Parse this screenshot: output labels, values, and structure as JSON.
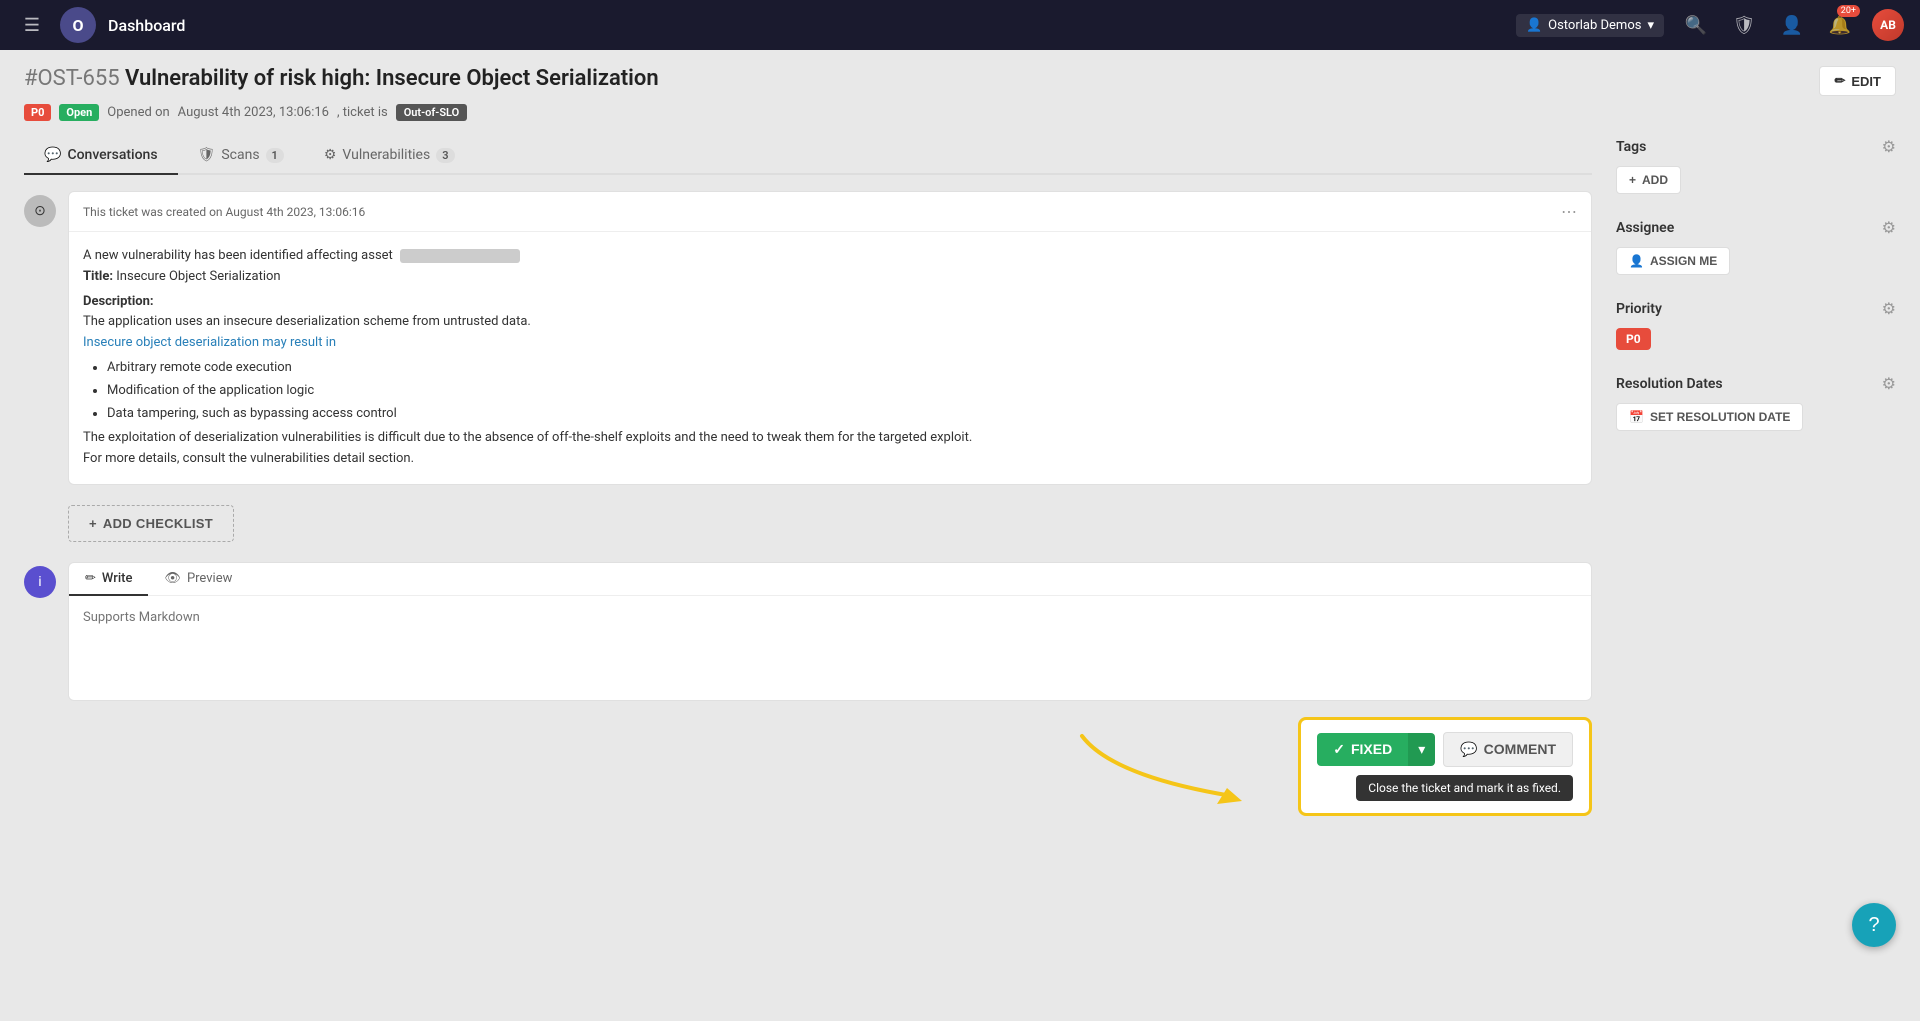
{
  "navbar": {
    "hamburger_label": "☰",
    "logo_text": "O",
    "title": "Dashboard",
    "org_name": "Ostorlab Demos",
    "search_icon": "🔍",
    "shield_icon": "🛡",
    "user_icon": "👤",
    "bell_icon": "🔔",
    "notification_count": "20+",
    "avatar_initials": "AB"
  },
  "ticket": {
    "id": "#OST-655",
    "title": "Vulnerability of risk high: Insecure Object Serialization",
    "priority_badge": "P0",
    "status_badge": "Open",
    "opened_text": "Opened on",
    "opened_date": "August 4th 2023, 13:06:16",
    "ticket_is_text": ", ticket is",
    "slo_badge": "Out-of-SLO",
    "edit_label": "EDIT"
  },
  "tabs": {
    "conversations": {
      "label": "Conversations",
      "active": true,
      "icon": "💬"
    },
    "scans": {
      "label": "Scans",
      "count": "1",
      "icon": "🛡"
    },
    "vulnerabilities": {
      "label": "Vulnerabilities",
      "count": "3",
      "icon": "⚙"
    }
  },
  "comment": {
    "header_text": "This ticket was created on August 4th 2023, 13:06:16",
    "more_icon": "⋯",
    "body": {
      "intro": "A new vulnerability has been identified affecting asset",
      "title_label": "Title:",
      "title_value": "Insecure Object Serialization",
      "description_label": "Description:",
      "desc_text": "The application uses an insecure deserialization scheme from untrusted data.",
      "blue_text": "Insecure object deserialization may result in",
      "bullets": [
        "Arbitrary remote code execution",
        "Modification of the application logic",
        "Data tampering, such as bypassing access control"
      ],
      "closing_text1": "The exploitation of deserialization vulnerabilities is difficult due to the absence of off-the-shelf exploits and the need to tweak them for the targeted exploit.",
      "closing_text2": "For more details, consult the vulnerabilities detail section."
    }
  },
  "add_checklist": {
    "label": "ADD CHECKLIST",
    "plus_icon": "+"
  },
  "write_section": {
    "write_tab_label": "Write",
    "preview_tab_label": "Preview",
    "write_icon": "✏",
    "preview_icon": "👁",
    "placeholder": "Supports Markdown"
  },
  "action_buttons": {
    "fixed_label": "FIXED",
    "fixed_check": "✓",
    "dropdown_icon": "▾",
    "comment_label": "COMMENT",
    "comment_icon": "💬",
    "tooltip": "Close the ticket and mark it as fixed."
  },
  "right_panel": {
    "tags": {
      "title": "Tags",
      "add_label": "ADD",
      "add_icon": "+"
    },
    "assignee": {
      "title": "Assignee",
      "assign_me_label": "ASSIGN ME",
      "assign_icon": "👤"
    },
    "priority": {
      "title": "Priority",
      "value": "P0"
    },
    "resolution_dates": {
      "title": "Resolution Dates",
      "set_label": "SET RESOLUTION DATE",
      "calendar_icon": "📅"
    }
  },
  "help_button": {
    "label": "?"
  }
}
